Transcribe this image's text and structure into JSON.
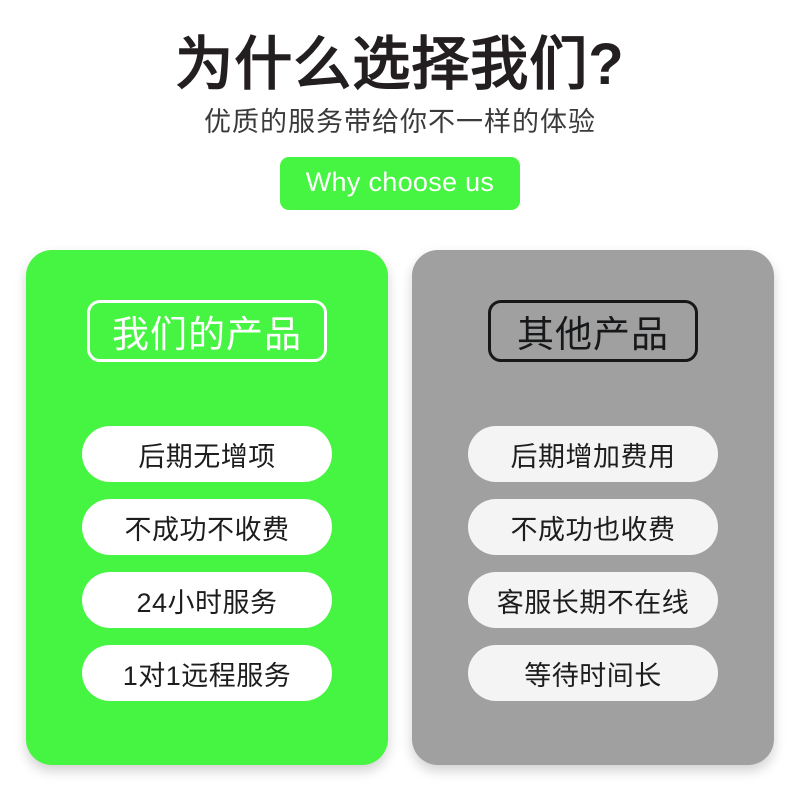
{
  "header": {
    "title": "为什么选择我们?",
    "subtitle": "优质的服务带给你不一样的体验",
    "badge": "Why choose us"
  },
  "colors": {
    "brand_green": "#46f541",
    "neutral_gray": "#a0a0a0",
    "title_black": "#231f20",
    "pill_white": "#ffffff",
    "pill_offwhite": "#f4f4f4"
  },
  "panels": [
    {
      "key": "ours",
      "header": "我们的产品",
      "items": [
        "后期无增项",
        "不成功不收费",
        "24小时服务",
        "1对1远程服务"
      ]
    },
    {
      "key": "others",
      "header": "其他产品",
      "items": [
        "后期增加费用",
        "不成功也收费",
        "客服长期不在线",
        "等待时间长"
      ]
    }
  ]
}
